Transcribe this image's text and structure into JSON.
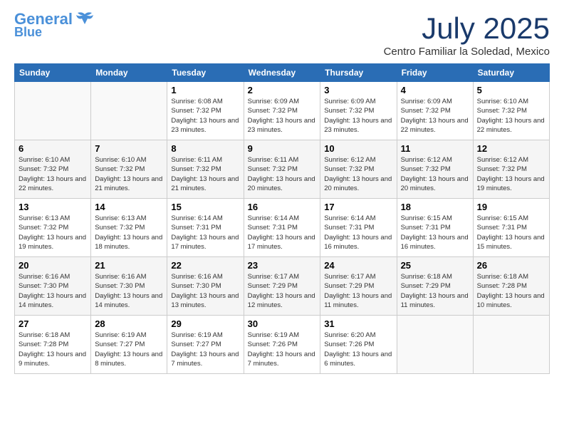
{
  "header": {
    "logo_line1": "General",
    "logo_line2": "Blue",
    "month": "July 2025",
    "location": "Centro Familiar la Soledad, Mexico"
  },
  "weekdays": [
    "Sunday",
    "Monday",
    "Tuesday",
    "Wednesday",
    "Thursday",
    "Friday",
    "Saturday"
  ],
  "weeks": [
    [
      {
        "day": "",
        "sunrise": "",
        "sunset": "",
        "daylight": ""
      },
      {
        "day": "",
        "sunrise": "",
        "sunset": "",
        "daylight": ""
      },
      {
        "day": "1",
        "sunrise": "Sunrise: 6:08 AM",
        "sunset": "Sunset: 7:32 PM",
        "daylight": "Daylight: 13 hours and 23 minutes."
      },
      {
        "day": "2",
        "sunrise": "Sunrise: 6:09 AM",
        "sunset": "Sunset: 7:32 PM",
        "daylight": "Daylight: 13 hours and 23 minutes."
      },
      {
        "day": "3",
        "sunrise": "Sunrise: 6:09 AM",
        "sunset": "Sunset: 7:32 PM",
        "daylight": "Daylight: 13 hours and 23 minutes."
      },
      {
        "day": "4",
        "sunrise": "Sunrise: 6:09 AM",
        "sunset": "Sunset: 7:32 PM",
        "daylight": "Daylight: 13 hours and 22 minutes."
      },
      {
        "day": "5",
        "sunrise": "Sunrise: 6:10 AM",
        "sunset": "Sunset: 7:32 PM",
        "daylight": "Daylight: 13 hours and 22 minutes."
      }
    ],
    [
      {
        "day": "6",
        "sunrise": "Sunrise: 6:10 AM",
        "sunset": "Sunset: 7:32 PM",
        "daylight": "Daylight: 13 hours and 22 minutes."
      },
      {
        "day": "7",
        "sunrise": "Sunrise: 6:10 AM",
        "sunset": "Sunset: 7:32 PM",
        "daylight": "Daylight: 13 hours and 21 minutes."
      },
      {
        "day": "8",
        "sunrise": "Sunrise: 6:11 AM",
        "sunset": "Sunset: 7:32 PM",
        "daylight": "Daylight: 13 hours and 21 minutes."
      },
      {
        "day": "9",
        "sunrise": "Sunrise: 6:11 AM",
        "sunset": "Sunset: 7:32 PM",
        "daylight": "Daylight: 13 hours and 20 minutes."
      },
      {
        "day": "10",
        "sunrise": "Sunrise: 6:12 AM",
        "sunset": "Sunset: 7:32 PM",
        "daylight": "Daylight: 13 hours and 20 minutes."
      },
      {
        "day": "11",
        "sunrise": "Sunrise: 6:12 AM",
        "sunset": "Sunset: 7:32 PM",
        "daylight": "Daylight: 13 hours and 20 minutes."
      },
      {
        "day": "12",
        "sunrise": "Sunrise: 6:12 AM",
        "sunset": "Sunset: 7:32 PM",
        "daylight": "Daylight: 13 hours and 19 minutes."
      }
    ],
    [
      {
        "day": "13",
        "sunrise": "Sunrise: 6:13 AM",
        "sunset": "Sunset: 7:32 PM",
        "daylight": "Daylight: 13 hours and 19 minutes."
      },
      {
        "day": "14",
        "sunrise": "Sunrise: 6:13 AM",
        "sunset": "Sunset: 7:32 PM",
        "daylight": "Daylight: 13 hours and 18 minutes."
      },
      {
        "day": "15",
        "sunrise": "Sunrise: 6:14 AM",
        "sunset": "Sunset: 7:31 PM",
        "daylight": "Daylight: 13 hours and 17 minutes."
      },
      {
        "day": "16",
        "sunrise": "Sunrise: 6:14 AM",
        "sunset": "Sunset: 7:31 PM",
        "daylight": "Daylight: 13 hours and 17 minutes."
      },
      {
        "day": "17",
        "sunrise": "Sunrise: 6:14 AM",
        "sunset": "Sunset: 7:31 PM",
        "daylight": "Daylight: 13 hours and 16 minutes."
      },
      {
        "day": "18",
        "sunrise": "Sunrise: 6:15 AM",
        "sunset": "Sunset: 7:31 PM",
        "daylight": "Daylight: 13 hours and 16 minutes."
      },
      {
        "day": "19",
        "sunrise": "Sunrise: 6:15 AM",
        "sunset": "Sunset: 7:31 PM",
        "daylight": "Daylight: 13 hours and 15 minutes."
      }
    ],
    [
      {
        "day": "20",
        "sunrise": "Sunrise: 6:16 AM",
        "sunset": "Sunset: 7:30 PM",
        "daylight": "Daylight: 13 hours and 14 minutes."
      },
      {
        "day": "21",
        "sunrise": "Sunrise: 6:16 AM",
        "sunset": "Sunset: 7:30 PM",
        "daylight": "Daylight: 13 hours and 14 minutes."
      },
      {
        "day": "22",
        "sunrise": "Sunrise: 6:16 AM",
        "sunset": "Sunset: 7:30 PM",
        "daylight": "Daylight: 13 hours and 13 minutes."
      },
      {
        "day": "23",
        "sunrise": "Sunrise: 6:17 AM",
        "sunset": "Sunset: 7:29 PM",
        "daylight": "Daylight: 13 hours and 12 minutes."
      },
      {
        "day": "24",
        "sunrise": "Sunrise: 6:17 AM",
        "sunset": "Sunset: 7:29 PM",
        "daylight": "Daylight: 13 hours and 11 minutes."
      },
      {
        "day": "25",
        "sunrise": "Sunrise: 6:18 AM",
        "sunset": "Sunset: 7:29 PM",
        "daylight": "Daylight: 13 hours and 11 minutes."
      },
      {
        "day": "26",
        "sunrise": "Sunrise: 6:18 AM",
        "sunset": "Sunset: 7:28 PM",
        "daylight": "Daylight: 13 hours and 10 minutes."
      }
    ],
    [
      {
        "day": "27",
        "sunrise": "Sunrise: 6:18 AM",
        "sunset": "Sunset: 7:28 PM",
        "daylight": "Daylight: 13 hours and 9 minutes."
      },
      {
        "day": "28",
        "sunrise": "Sunrise: 6:19 AM",
        "sunset": "Sunset: 7:27 PM",
        "daylight": "Daylight: 13 hours and 8 minutes."
      },
      {
        "day": "29",
        "sunrise": "Sunrise: 6:19 AM",
        "sunset": "Sunset: 7:27 PM",
        "daylight": "Daylight: 13 hours and 7 minutes."
      },
      {
        "day": "30",
        "sunrise": "Sunrise: 6:19 AM",
        "sunset": "Sunset: 7:26 PM",
        "daylight": "Daylight: 13 hours and 7 minutes."
      },
      {
        "day": "31",
        "sunrise": "Sunrise: 6:20 AM",
        "sunset": "Sunset: 7:26 PM",
        "daylight": "Daylight: 13 hours and 6 minutes."
      },
      {
        "day": "",
        "sunrise": "",
        "sunset": "",
        "daylight": ""
      },
      {
        "day": "",
        "sunrise": "",
        "sunset": "",
        "daylight": ""
      }
    ]
  ]
}
